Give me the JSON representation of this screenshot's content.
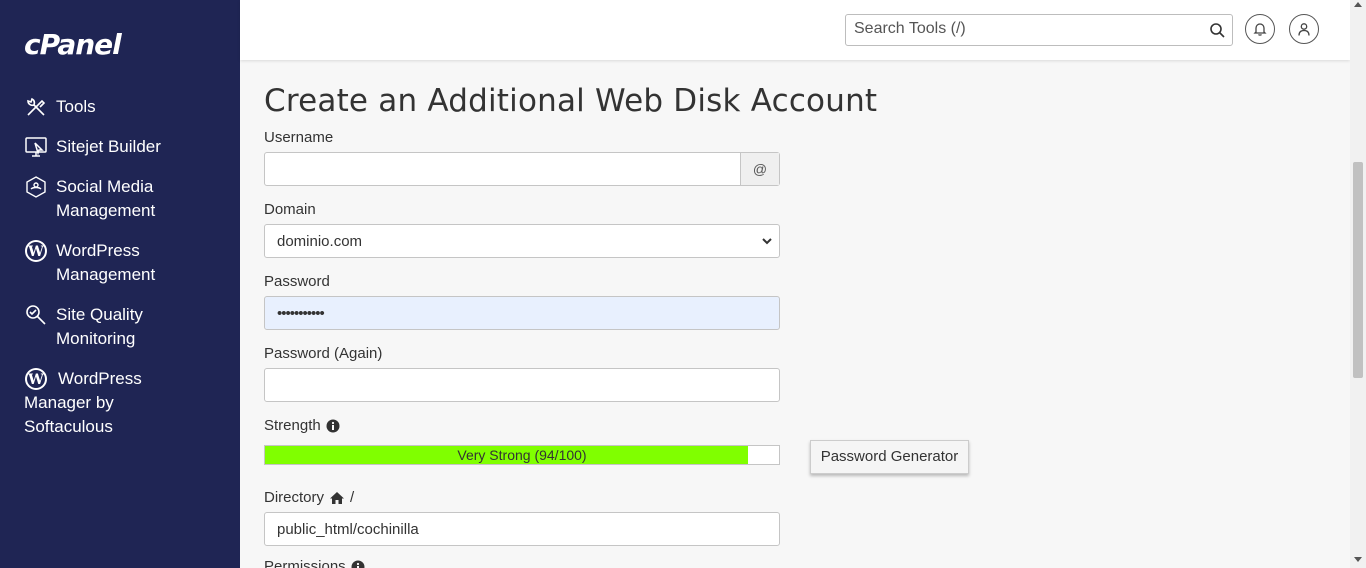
{
  "sidebar": {
    "logo": "cPanel",
    "items": [
      {
        "label": "Tools",
        "icon": "tools-icon"
      },
      {
        "label": "Sitejet Builder",
        "icon": "sitejet-icon"
      },
      {
        "label": "Social Media Management",
        "icon": "social-media-icon"
      },
      {
        "label": "WordPress Management",
        "icon": "wordpress-icon"
      },
      {
        "label": "Site Quality Monitoring",
        "icon": "site-quality-icon"
      },
      {
        "label": "WordPress Manager by Softaculous",
        "icon": "wordpress-icon"
      }
    ]
  },
  "header": {
    "search_placeholder": "Search Tools (/)"
  },
  "form": {
    "title": "Create an Additional Web Disk Account",
    "username_label": "Username",
    "username_value": "",
    "username_addon": "@",
    "domain_label": "Domain",
    "domain_value": "dominio.com",
    "password_label": "Password",
    "password_value": "•••••••••••",
    "password_again_label": "Password (Again)",
    "password_again_value": "",
    "strength_label": "Strength",
    "strength_text": "Very Strong (94/100)",
    "strength_score": 94,
    "password_generator_label": "Password Generator",
    "directory_label": "Directory",
    "directory_separator": "/",
    "directory_value": "public_html/cochinilla",
    "permissions_label": "Permissions"
  },
  "colors": {
    "sidebar_bg": "#1f2554",
    "strength_fill": "#80ff00",
    "autofill_bg": "#e8f0fe"
  }
}
